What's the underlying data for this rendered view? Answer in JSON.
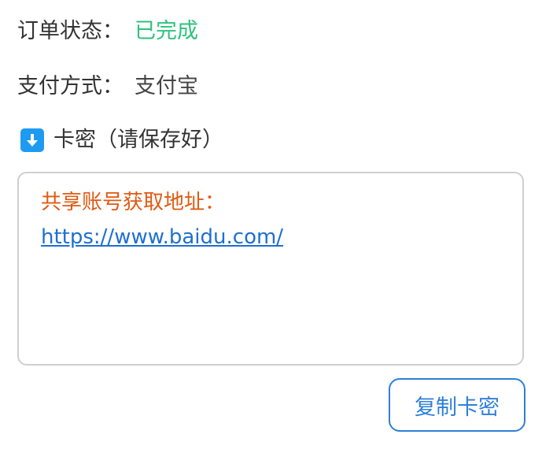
{
  "order": {
    "status_label": "订单状态：",
    "status_value": "已完成",
    "payment_label": "支付方式：",
    "payment_value": "支付宝"
  },
  "card": {
    "icon": "download-arrow-icon",
    "title": "卡密（请保存好）",
    "share_label": "共享账号获取地址：",
    "share_link": "https://www.baidu.com/"
  },
  "actions": {
    "copy_label": "复制卡密"
  },
  "colors": {
    "status_green": "#2ec27e",
    "accent_blue": "#2f7fd8",
    "icon_blue": "#1e9bf0",
    "warning_orange": "#e05a12"
  }
}
